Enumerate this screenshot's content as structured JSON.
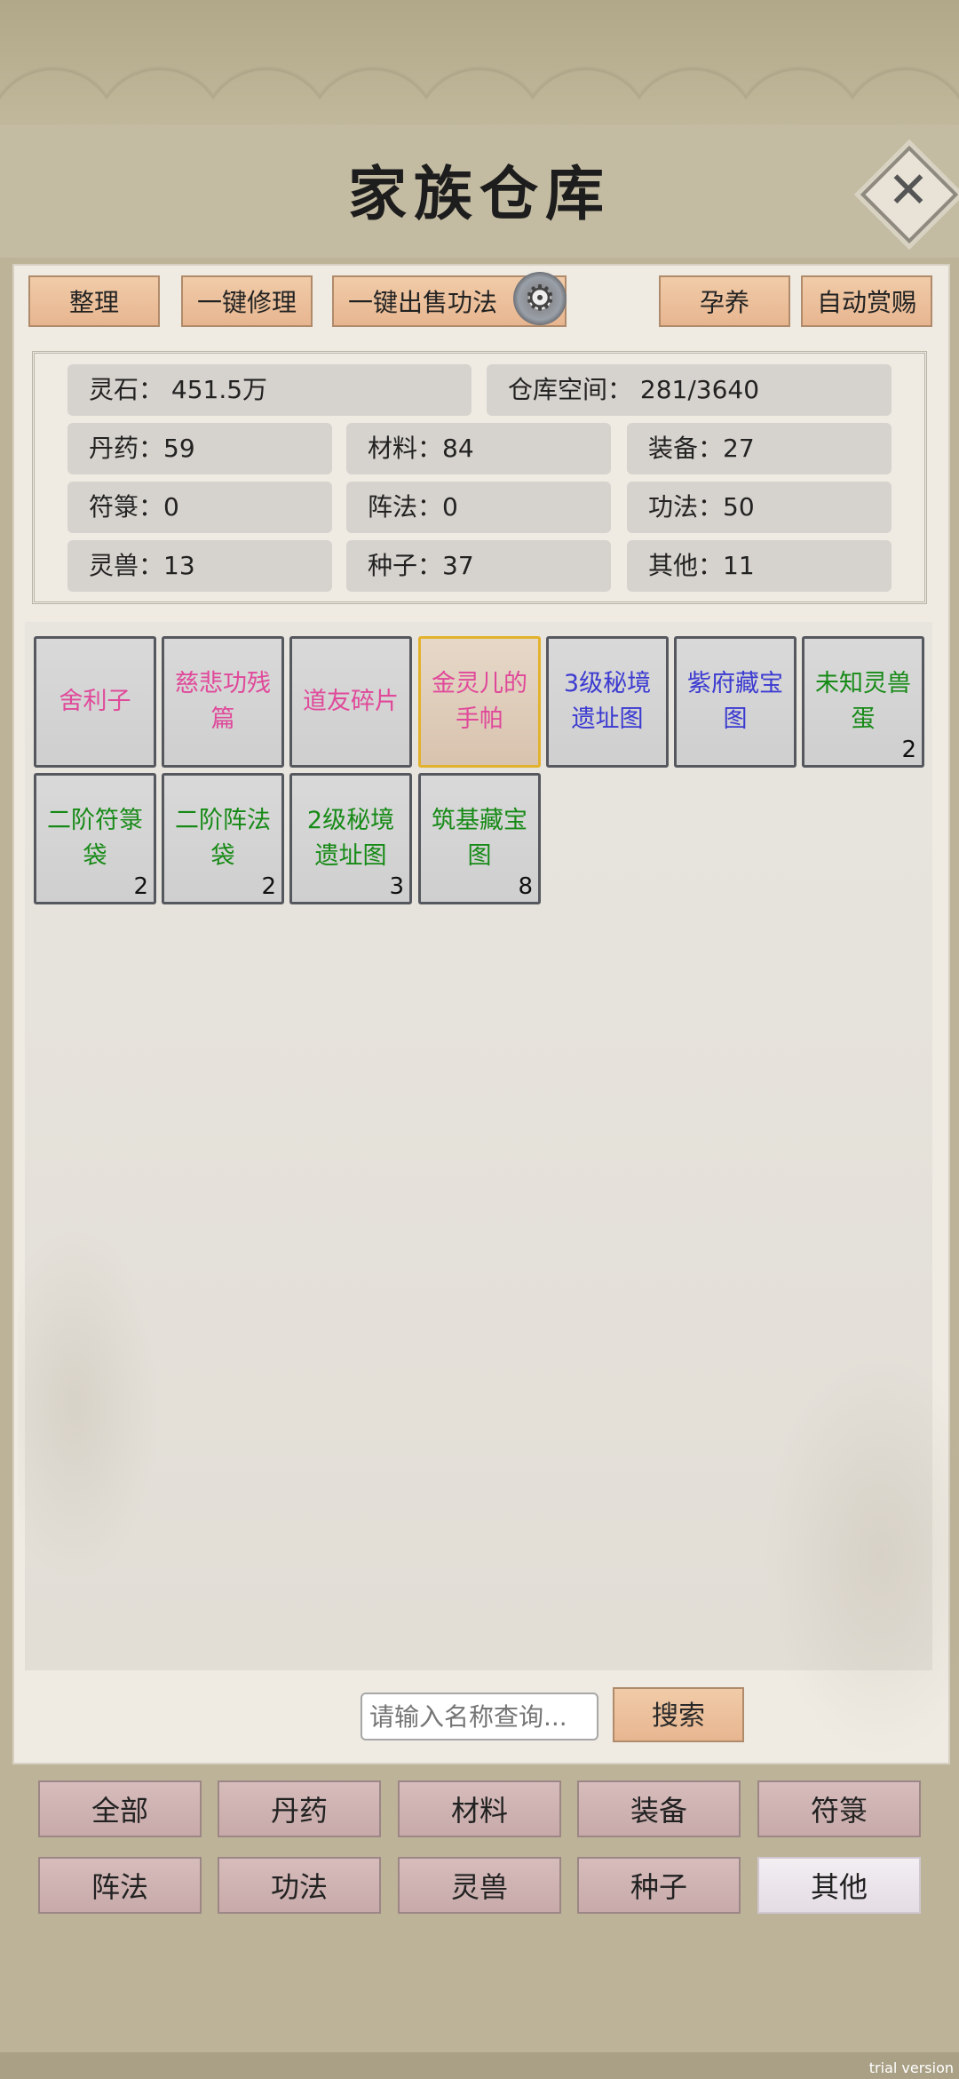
{
  "title": "家族仓库",
  "toolbar": {
    "organize": "整理",
    "repair_all": "一键修理",
    "sell_skills": "一键出售功法",
    "nurture": "孕养",
    "auto_reward": "自动赏赐"
  },
  "stats": {
    "spirit_stone": "灵石：  451.5万",
    "storage": "仓库空间：   281/3640",
    "pills": "丹药：59",
    "materials": "材料：84",
    "equipment": "装备：27",
    "talismans": "符箓：0",
    "formations": "阵法：0",
    "skills": "功法：50",
    "beasts": "灵兽：13",
    "seeds": "种子：37",
    "others": "其他：11"
  },
  "items": [
    {
      "label": "舍利子",
      "count": ""
    },
    {
      "label": "慈悲功残篇",
      "count": ""
    },
    {
      "label": "道友碎片",
      "count": ""
    },
    {
      "label": "金灵儿的手帕",
      "count": ""
    },
    {
      "label": "3级秘境遗址图",
      "count": ""
    },
    {
      "label": "紫府藏宝图",
      "count": ""
    },
    {
      "label": "未知灵兽蛋",
      "count": "2"
    },
    {
      "label": "二阶符箓袋",
      "count": "2"
    },
    {
      "label": "二阶阵法袋",
      "count": "2"
    },
    {
      "label": "2级秘境遗址图",
      "count": "3"
    },
    {
      "label": "筑基藏宝图",
      "count": "8"
    }
  ],
  "search": {
    "placeholder": "请输入名称查询...",
    "button": "搜索"
  },
  "categories": [
    "全部",
    "丹药",
    "材料",
    "装备",
    "符箓",
    "阵法",
    "功法",
    "灵兽",
    "种子",
    "其他"
  ],
  "watermark": "trial version",
  "colors": {
    "pink": "#e0499a",
    "blue": "#3b3ad1",
    "green": "#178a17",
    "selected_border": "#e3b22c"
  }
}
